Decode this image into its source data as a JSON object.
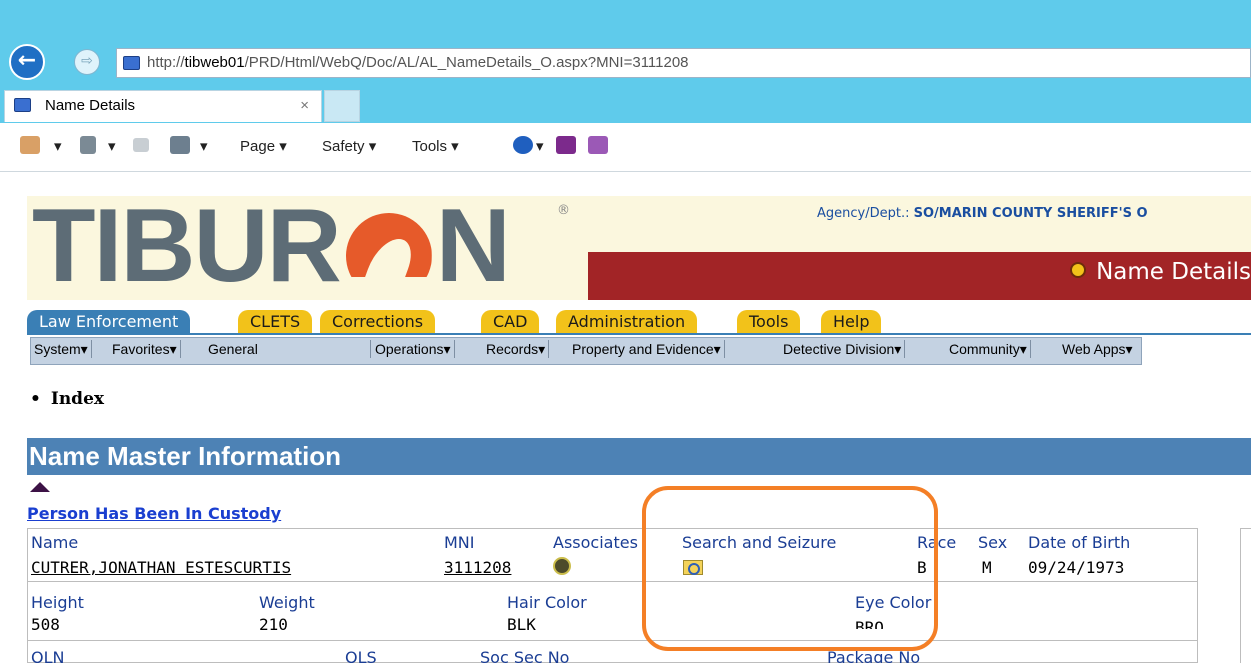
{
  "browser": {
    "address_prefix": "http://",
    "address_host": "tibweb01",
    "address_path": "/PRD/Html/WebQ/Doc/AL/AL_NameDetails_O.aspx?MNI=3111208",
    "tab_title": "Name Details",
    "tab_close": "×",
    "back_glyph": "←",
    "forward_glyph": "⇨",
    "commands": {
      "page": "Page ▾",
      "safety": "Safety ▾",
      "tools": "Tools ▾",
      "dropdown": "▾"
    }
  },
  "header": {
    "logo_text": "TIBUR",
    "logo_text_end": "N",
    "logo_mark": "®",
    "agency_label": "Agency/Dept.:",
    "agency_value": "SO/MARIN COUNTY SHERIFF'S O",
    "page_title": "Name Details"
  },
  "module_tabs": [
    "Law Enforcement",
    "CLETS",
    "Corrections",
    "CAD",
    "Administration",
    "Tools",
    "Help"
  ],
  "menu_bar": [
    "System▾",
    "Favorites▾",
    "General",
    "Operations▾",
    "Records▾",
    "Property and Evidence▾",
    "Detective Division▾",
    "Community▾",
    "Web Apps▾"
  ],
  "index_label": "Index",
  "section": {
    "title": "Name Master Information",
    "custody_link": "Person Has Been In Custody"
  },
  "record": {
    "labels": {
      "name": "Name",
      "mni": "MNI",
      "associates": "Associates",
      "search_seizure": "Search and Seizure",
      "race": "Race",
      "sex": "Sex",
      "dob": "Date of Birth",
      "height": "Height",
      "weight": "Weight",
      "hair": "Hair Color",
      "eye": "Eye Color",
      "oln": "OLN",
      "ols": "OLS",
      "ssn": "Soc Sec No",
      "package": "Package No"
    },
    "values": {
      "name": "CUTRER,JONATHAN ESTESCURTIS",
      "mni": "3111208",
      "race": "B",
      "sex": "M",
      "dob": "09/24/1973",
      "height": "508",
      "weight": "210",
      "hair": "BLK",
      "eye": "BRO"
    }
  },
  "colors": {
    "chrome": "#5fcbeb",
    "brand_red": "#a22426",
    "tab_yellow": "#f2c21a",
    "tab_blue": "#3a7fb5",
    "section_blue": "#4d82b5",
    "highlight": "#f47f26"
  }
}
